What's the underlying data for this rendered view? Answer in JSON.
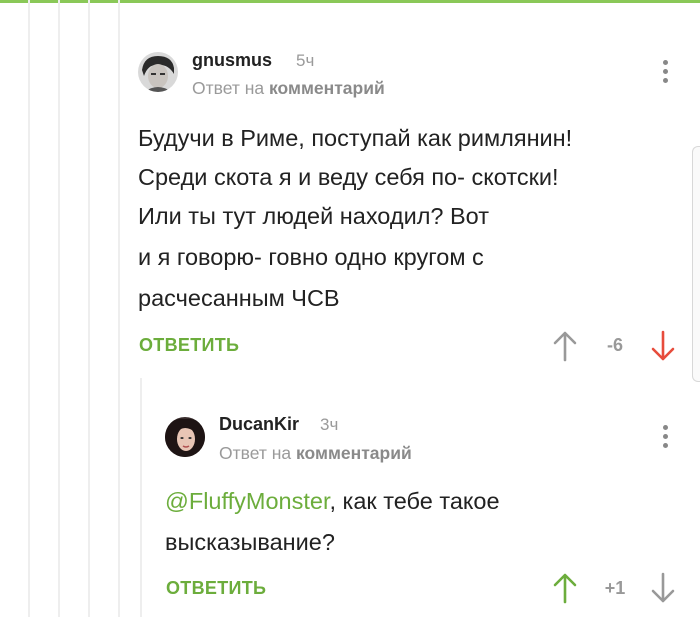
{
  "comments": [
    {
      "username": "gnusmus",
      "time": "5ч",
      "reply_prefix": "Ответ на",
      "reply_link": "комментарий",
      "lines": [
        "Будучи в Риме, поступай как римлянин!",
        "Среди скота я и веду себя по- скотски!",
        "Или ты тут людей находил? Вот",
        "и я говорю- говно одно кругом с",
        "расчесанным ЧСВ"
      ],
      "reply_label": "ОТВЕТИТЬ",
      "rating": "-6",
      "vote_state": "down"
    },
    {
      "username": "DucanKir",
      "time": "3ч",
      "reply_prefix": "Ответ на",
      "reply_link": "комментарий",
      "mention": "@FluffyMonster",
      "line1_rest": ", как тебе такое",
      "line2": "высказывание?",
      "reply_label": "ОТВЕТИТЬ",
      "rating": "+1",
      "vote_state": "up"
    }
  ],
  "colors": {
    "accent_green": "#6cad3c",
    "downvote_red": "#e74c3c",
    "neutral_arrow": "#999999",
    "top_bar": "#8ac858"
  },
  "icons": [
    "kebab-menu-icon",
    "arrow-up-icon",
    "arrow-down-icon"
  ]
}
